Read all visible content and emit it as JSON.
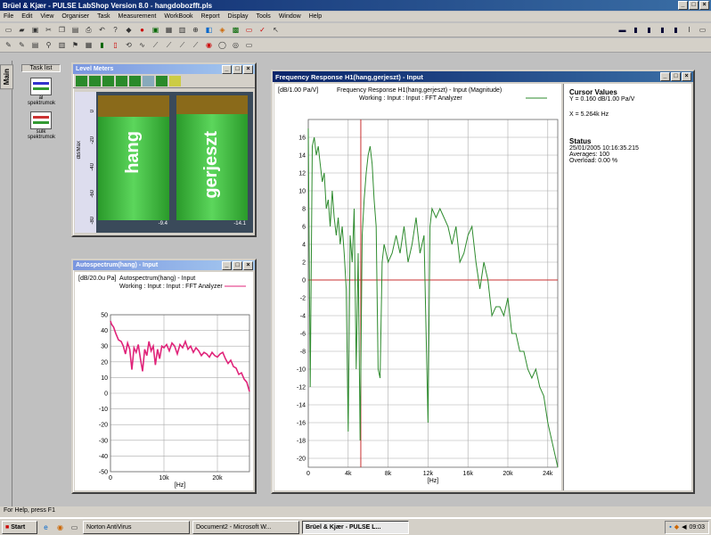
{
  "app": {
    "title": "Brüel & Kjær - PULSE LabShop Version 8.0 - hangdobozfft.pls"
  },
  "menu": [
    "File",
    "Edit",
    "View",
    "Organiser",
    "Task",
    "Measurement",
    "WorkBook",
    "Report",
    "Display",
    "Tools",
    "Window",
    "Help"
  ],
  "sidebar": {
    "tab": "Main",
    "header": "Task list",
    "items": [
      {
        "label": "ál spektrumok"
      },
      {
        "label": "sulk spektrumok"
      }
    ]
  },
  "level_meters": {
    "title": "Level Meters",
    "unit": "dB/Max",
    "ticks": [
      "0",
      "-20",
      "-40",
      "-60",
      "-80"
    ],
    "channels": [
      {
        "name": "hang",
        "value": "-9.4",
        "level": 0.83
      },
      {
        "name": "gerjeszt",
        "value": "-14.1",
        "level": 0.85
      }
    ]
  },
  "autospectrum": {
    "title": "Autospectrum(hang) - Input",
    "yunit": "[dB/20.0u Pa]",
    "header": "Autospectrum(hang) - Input",
    "working": "Working : Input : Input : FFT Analyzer",
    "xunit": "[Hz]",
    "color": "#e0247a"
  },
  "freq_response": {
    "title": "Frequency Response H1(hang,gerjeszt) - Input",
    "yunit": "[dB/1.00 Pa/V]",
    "header": "Frequency Response H1(hang,gerjeszt) - Input (Magnitude)",
    "working": "Working : Input : Input : FFT Analyzer",
    "xunit": "[Hz]",
    "color": "#2e8b2e",
    "cursor_color": "#c83030"
  },
  "cursor_values": {
    "title": "Cursor Values",
    "y": "Y = 0.160 dB/1.00 Pa/V",
    "x": "X = 5.264k Hz",
    "status_title": "Status",
    "date": "25/01/2005 10:16:35.215",
    "averages": "Averages: 100",
    "overload": "Overload:  0.00 %"
  },
  "status_bar": "For Help, press F1",
  "taskbar": {
    "start": "Start",
    "buttons": [
      {
        "label": "Norton AntiVirus",
        "active": false
      },
      {
        "label": "Document2 - Microsoft W...",
        "active": false
      },
      {
        "label": "Brüel & Kjær - PULSE L...",
        "active": true
      }
    ],
    "clock": "09:03"
  },
  "chart_data": [
    {
      "type": "line",
      "title": "Autospectrum(hang) - Input",
      "xlabel": "[Hz]",
      "ylabel": "[dB/20.0u Pa]",
      "xlim": [
        0,
        26000
      ],
      "ylim": [
        -50,
        50
      ],
      "xticks": [
        {
          "v": 0,
          "l": "0"
        },
        {
          "v": 10000,
          "l": "10k"
        },
        {
          "v": 20000,
          "l": "20k"
        }
      ],
      "yticks": [
        50,
        40,
        30,
        20,
        10,
        0,
        -10,
        -20,
        -30,
        -40,
        -50
      ],
      "series": [
        {
          "name": "Autospectrum(hang) - Input",
          "x": [
            0,
            200,
            600,
            1000,
            1500,
            2000,
            2400,
            2800,
            3200,
            3600,
            4000,
            4400,
            4800,
            5200,
            5600,
            6000,
            6400,
            6800,
            7200,
            7600,
            8000,
            8400,
            8800,
            9200,
            9600,
            10000,
            10500,
            11000,
            11500,
            12000,
            12500,
            13000,
            13500,
            14000,
            14500,
            15000,
            15500,
            16000,
            16500,
            17000,
            17500,
            18000,
            18500,
            19000,
            19500,
            20000,
            20500,
            21000,
            21500,
            22000,
            22500,
            23000,
            23500,
            24000,
            24500,
            25000,
            25500,
            26000
          ],
          "values": [
            46,
            44,
            42,
            38,
            34,
            33,
            30,
            25,
            32,
            28,
            15,
            29,
            26,
            31,
            22,
            14,
            28,
            24,
            33,
            27,
            30,
            18,
            28,
            22,
            30,
            29,
            31,
            27,
            32,
            30,
            25,
            31,
            29,
            33,
            28,
            30,
            26,
            29,
            27,
            24,
            26,
            25,
            23,
            26,
            24,
            23,
            25,
            26,
            22,
            19,
            21,
            17,
            16,
            12,
            13,
            9,
            7,
            1
          ]
        }
      ]
    },
    {
      "type": "line",
      "title": "Frequency Response H1(hang,gerjeszt) - Input (Magnitude)",
      "xlabel": "[Hz]",
      "ylabel": "[dB/1.00 Pa/V]",
      "xlim": [
        0,
        25000
      ],
      "ylim": [
        -21,
        18
      ],
      "xticks": [
        {
          "v": 0,
          "l": "0"
        },
        {
          "v": 4000,
          "l": "4k"
        },
        {
          "v": 8000,
          "l": "8k"
        },
        {
          "v": 12000,
          "l": "12k"
        },
        {
          "v": 16000,
          "l": "16k"
        },
        {
          "v": 20000,
          "l": "20k"
        },
        {
          "v": 24000,
          "l": "24k"
        }
      ],
      "yticks": [
        16,
        14,
        12,
        10,
        8,
        6,
        4,
        2,
        0,
        -2,
        -4,
        -6,
        -8,
        -10,
        -12,
        -14,
        -16,
        -18,
        -20
      ],
      "cursor_x": 5264,
      "series": [
        {
          "name": "Frequency Response H1(hang,gerjeszt) - Input (Magnitude)",
          "x": [
            0,
            200,
            400,
            600,
            800,
            1000,
            1200,
            1400,
            1600,
            1800,
            2000,
            2200,
            2400,
            2600,
            2800,
            3000,
            3200,
            3400,
            3600,
            3800,
            4000,
            4200,
            4400,
            4600,
            4800,
            5000,
            5200,
            5400,
            5600,
            5800,
            6000,
            6200,
            6400,
            6600,
            6800,
            7000,
            7200,
            7400,
            7600,
            7800,
            8000,
            8400,
            8800,
            9200,
            9600,
            10000,
            10400,
            10800,
            11200,
            11600,
            12000,
            12200,
            12400,
            12800,
            13200,
            13600,
            14000,
            14400,
            14800,
            15200,
            15600,
            16000,
            16400,
            16800,
            17200,
            17600,
            18000,
            18400,
            18800,
            19200,
            19600,
            20000,
            20400,
            20800,
            21200,
            21600,
            22000,
            22400,
            22800,
            23200,
            23600,
            24000,
            24400,
            24800,
            25000
          ],
          "values": [
            17,
            -12,
            15,
            16,
            14,
            15,
            13,
            11,
            12,
            8,
            9,
            6,
            10,
            7,
            5,
            7,
            4,
            6,
            3,
            -1,
            -17,
            5,
            2,
            8,
            -10,
            3,
            -18,
            5,
            9,
            12,
            14,
            15,
            13,
            9,
            6,
            -10,
            -11,
            2,
            4,
            3,
            2,
            3,
            5,
            3,
            6,
            2,
            4,
            7,
            3,
            5,
            -16,
            6,
            8,
            7,
            8,
            7,
            6,
            4,
            6,
            2,
            3,
            5,
            6,
            2,
            -1,
            2,
            0,
            -4,
            -3,
            -3,
            -4,
            -2,
            -6,
            -6,
            -8,
            -8,
            -10,
            -11,
            -10,
            -12,
            -13,
            -16,
            -18,
            -20,
            -21
          ]
        }
      ]
    }
  ]
}
